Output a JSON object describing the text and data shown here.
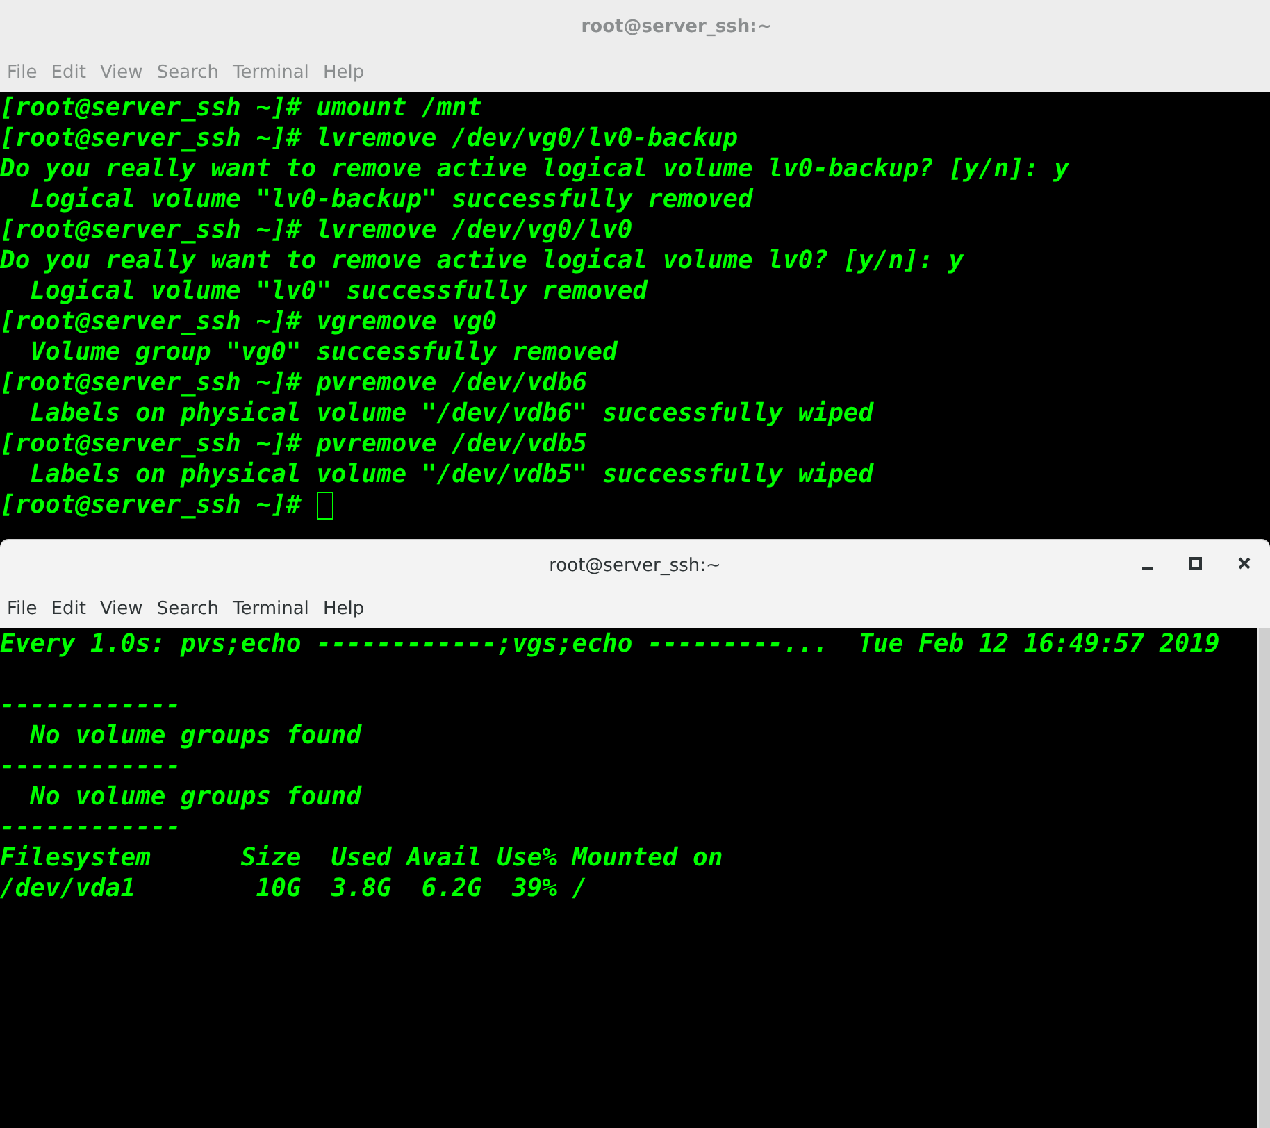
{
  "windows": [
    {
      "title": "root@server_ssh:~",
      "active": false,
      "menu": [
        "File",
        "Edit",
        "View",
        "Search",
        "Terminal",
        "Help"
      ],
      "terminal": {
        "cursor": true,
        "lines": [
          "[root@server_ssh ~]# umount /mnt",
          "[root@server_ssh ~]# lvremove /dev/vg0/lv0-backup",
          "Do you really want to remove active logical volume lv0-backup? [y/n]: y",
          "  Logical volume \"lv0-backup\" successfully removed",
          "[root@server_ssh ~]# lvremove /dev/vg0/lv0",
          "Do you really want to remove active logical volume lv0? [y/n]: y",
          "  Logical volume \"lv0\" successfully removed",
          "[root@server_ssh ~]# vgremove vg0",
          "  Volume group \"vg0\" successfully removed",
          "[root@server_ssh ~]# pvremove /dev/vdb6",
          "  Labels on physical volume \"/dev/vdb6\" successfully wiped",
          "[root@server_ssh ~]# pvremove /dev/vdb5",
          "  Labels on physical volume \"/dev/vdb5\" successfully wiped",
          "[root@server_ssh ~]# "
        ]
      }
    },
    {
      "title": "root@server_ssh:~",
      "active": true,
      "menu": [
        "File",
        "Edit",
        "View",
        "Search",
        "Terminal",
        "Help"
      ],
      "terminal": {
        "header": "Every 1.0s: pvs;echo ------------;vgs;echo ---------...  Tue Feb 12 16:49:57 2019",
        "lines": [
          "------------",
          "  No volume groups found",
          "------------",
          "  No volume groups found",
          "------------",
          "Filesystem      Size  Used Avail Use% Mounted on",
          "/dev/vda1        10G  3.8G  6.2G  39% /"
        ]
      }
    }
  ]
}
